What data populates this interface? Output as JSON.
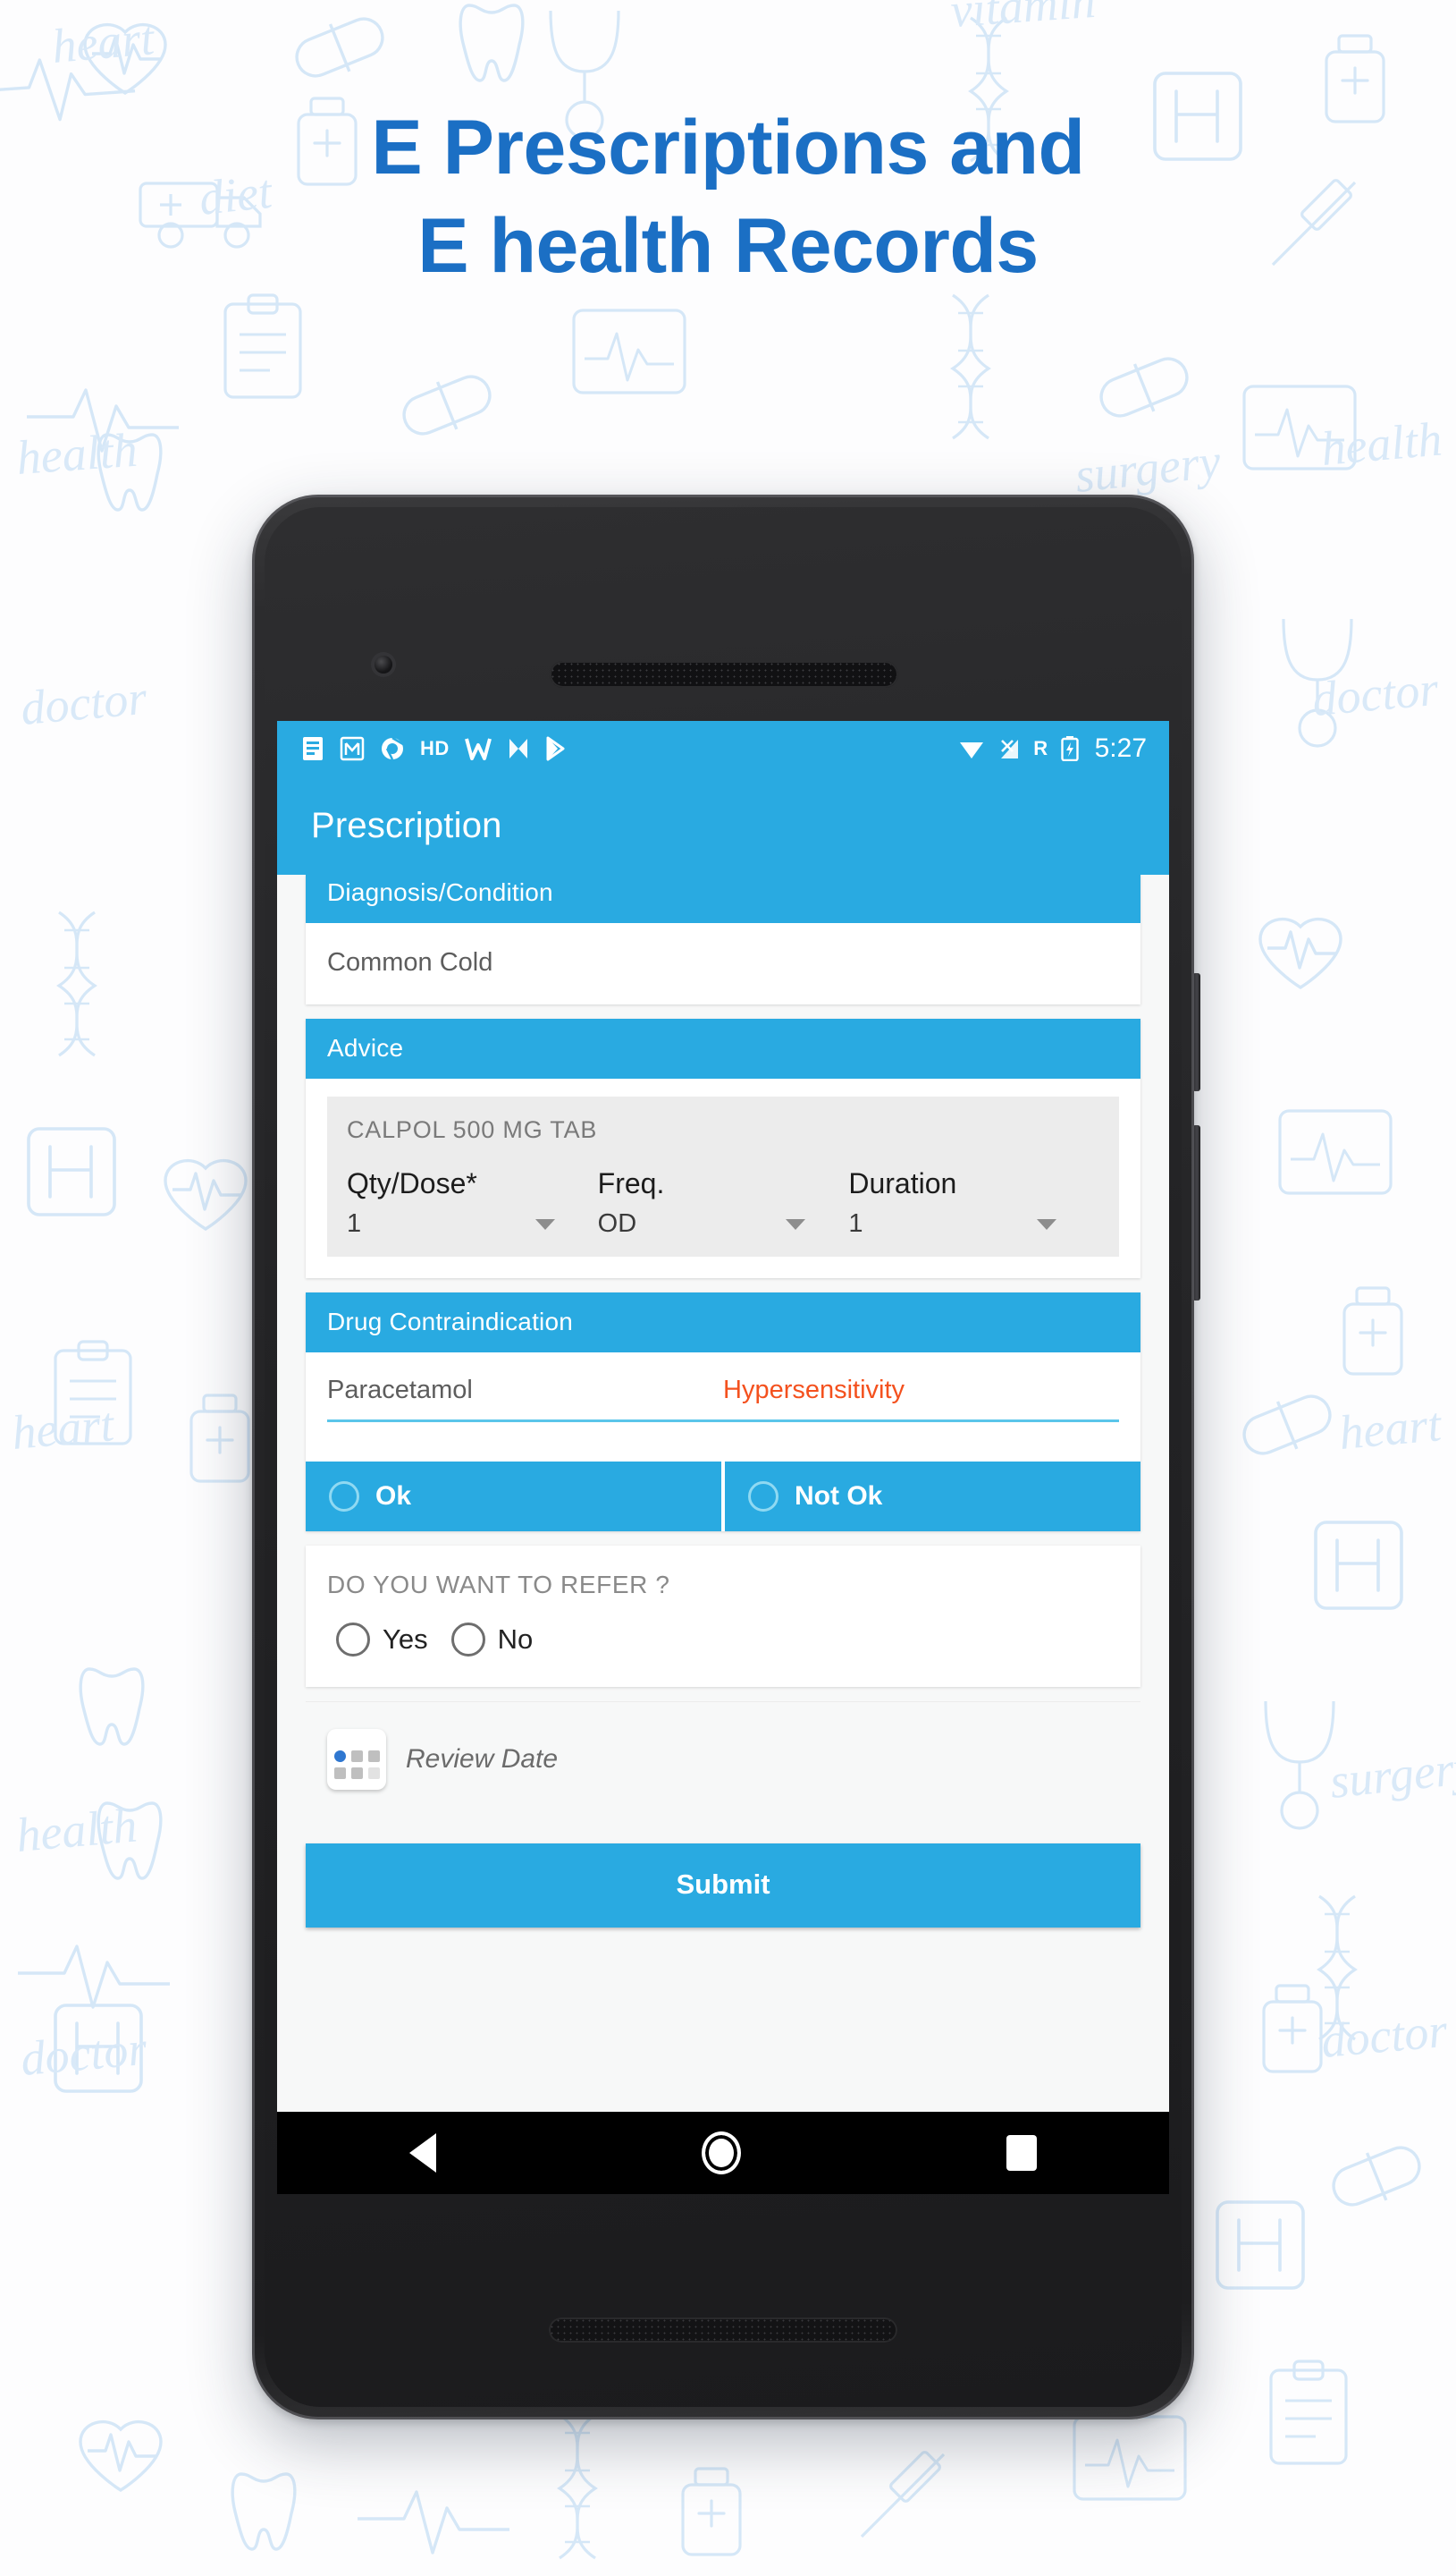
{
  "promo": {
    "headline_line1": "E Prescriptions and",
    "headline_line2": "E health Records",
    "headline_color": "#1b6fc4",
    "background_doodle_words": [
      "heart",
      "diet",
      "doctor",
      "health",
      "surgery",
      "vitamin"
    ]
  },
  "theme": {
    "accent": "#29aae1",
    "warning": "#f4511e",
    "surface": "#ffffff",
    "page_background": "#f7f8f8"
  },
  "statusbar": {
    "icons": [
      "notes-icon",
      "gmail-icon",
      "chrome-icon",
      "hd-icon",
      "wordpress-icon",
      "nfc-icon",
      "play-store-icon"
    ],
    "hd_label": "HD",
    "right_icons": [
      "wifi-icon",
      "signal-icon",
      "battery-charging-icon"
    ],
    "roaming_label": "R",
    "clock": "5:27"
  },
  "appbar": {
    "title": "Prescription"
  },
  "sections": {
    "diagnosis": {
      "header": "Diagnosis/Condition",
      "value": "Common Cold"
    },
    "advice": {
      "header": "Advice",
      "drug_name": "CALPOL 500 MG TAB",
      "fields": [
        {
          "label": "Qty/Dose*",
          "value": "1"
        },
        {
          "label": "Freq.",
          "value": "OD"
        },
        {
          "label": "Duration",
          "value": "1"
        }
      ]
    },
    "contraindication": {
      "header": "Drug Contraindication",
      "drug": "Paracetamol",
      "warning": "Hypersensitivity",
      "options": [
        {
          "label": "Ok"
        },
        {
          "label": "Not Ok"
        }
      ]
    },
    "refer": {
      "question": "DO YOU WANT TO REFER ?",
      "options": [
        {
          "label": "Yes"
        },
        {
          "label": "No"
        }
      ]
    },
    "review_date": {
      "icon": "calendar-icon",
      "placeholder": "Review Date"
    },
    "submit": {
      "label": "Submit"
    }
  },
  "navbar": {
    "buttons": [
      "back-button",
      "home-button",
      "recents-button"
    ]
  }
}
